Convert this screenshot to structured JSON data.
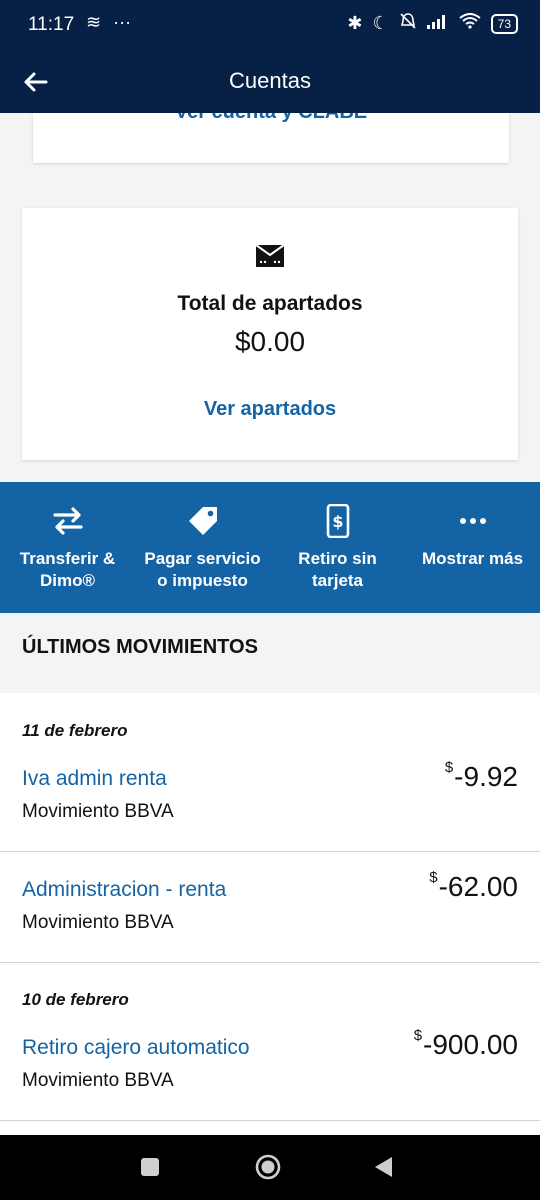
{
  "status_bar": {
    "time": "11:17",
    "battery": "73",
    "left_icons": [
      "layers-icon",
      "more-dots-icon"
    ],
    "right_icons": [
      "bluetooth-icon",
      "moon-icon",
      "bell-off-icon",
      "signal-icon",
      "wifi-icon",
      "battery-icon"
    ]
  },
  "app_bar": {
    "title": "Cuentas",
    "back_icon": "arrow-left-icon"
  },
  "account_card": {
    "link": "Ver cuenta y CLABE"
  },
  "apartados_card": {
    "icon": "wallet-icon",
    "label": "Total de apartados",
    "amount": "$0.00",
    "link": "Ver apartados"
  },
  "quick_actions": [
    {
      "icon": "transfer-icon",
      "label_line1": "Transferir &",
      "label_line2": "Dimo®"
    },
    {
      "icon": "tag-icon",
      "label_line1": "Pagar servicio",
      "label_line2": "o impuesto"
    },
    {
      "icon": "phone-dollar-icon",
      "label_line1": "Retiro sin",
      "label_line2": "tarjeta"
    },
    {
      "icon": "more-icon",
      "label_line1": "Mostrar más",
      "label_line2": ""
    }
  ],
  "movements_section": {
    "title": "ÚLTIMOS MOVIMIENTOS",
    "groups": [
      {
        "date": "11 de febrero",
        "items": [
          {
            "title": "Iva admin renta",
            "subtitle": "Movimiento BBVA",
            "currency": "$",
            "amount": "-9.92"
          },
          {
            "title": "Administracion - renta",
            "subtitle": "Movimiento BBVA",
            "currency": "$",
            "amount": "-62.00"
          }
        ]
      },
      {
        "date": "10 de febrero",
        "items": [
          {
            "title": "Retiro cajero automatico",
            "subtitle": "Movimiento BBVA",
            "currency": "$",
            "amount": "-900.00"
          }
        ]
      }
    ]
  },
  "nav_bar": [
    "recents-square-icon",
    "home-circle-icon",
    "back-triangle-icon"
  ],
  "colors": {
    "navy": "#072146",
    "blue": "#1464a5",
    "background": "#f4f4f4"
  }
}
